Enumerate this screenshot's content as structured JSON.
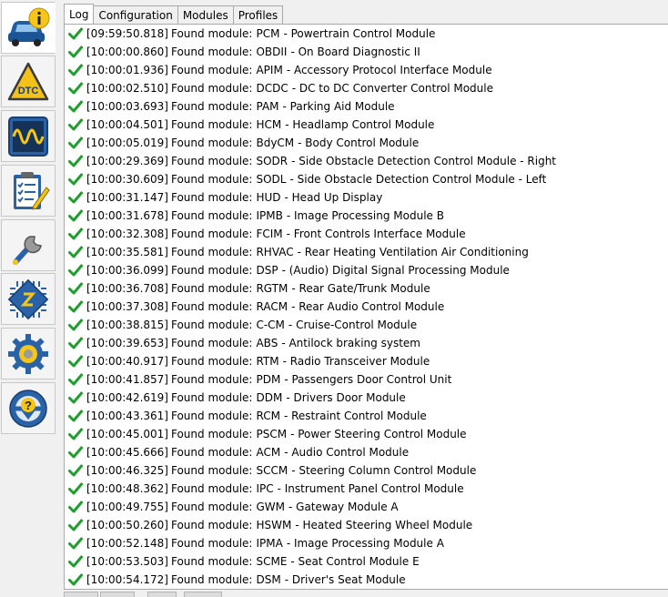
{
  "sidebar": {
    "items": [
      {
        "name": "vehicle-info",
        "icon": "car-info-icon"
      },
      {
        "name": "dtc",
        "icon": "dtc-warning-icon",
        "label": "DTC"
      },
      {
        "name": "oscilloscope",
        "icon": "oscilloscope-icon"
      },
      {
        "name": "checklist",
        "icon": "checklist-icon"
      },
      {
        "name": "service",
        "icon": "wrench-icon"
      },
      {
        "name": "module-chip",
        "icon": "chip-icon"
      },
      {
        "name": "settings",
        "icon": "gear-icon"
      },
      {
        "name": "help",
        "icon": "help-steering-icon"
      }
    ]
  },
  "tabs": [
    {
      "label": "Log",
      "active": true
    },
    {
      "label": "Configuration",
      "active": false
    },
    {
      "label": "Modules",
      "active": false
    },
    {
      "label": "Profiles",
      "active": false
    }
  ],
  "log": {
    "found_text": "Found module:",
    "entries": [
      {
        "time": "[09:59:50.818]",
        "code": "PCM",
        "desc": "- Powertrain Control Module"
      },
      {
        "time": "[10:00:00.860]",
        "code": "OBDII",
        "desc": "- On Board Diagnostic II"
      },
      {
        "time": "[10:00:01.936]",
        "code": "APIM",
        "desc": "- Accessory Protocol Interface Module"
      },
      {
        "time": "[10:00:02.510]",
        "code": "DCDC",
        "desc": "- DC to DC Converter Control Module"
      },
      {
        "time": "[10:00:03.693]",
        "code": "PAM",
        "desc": "- Parking Aid Module"
      },
      {
        "time": "[10:00:04.501]",
        "code": "HCM",
        "desc": "- Headlamp Control Module"
      },
      {
        "time": "[10:00:05.019]",
        "code": "BdyCM",
        "desc": "- Body Control Module"
      },
      {
        "time": "[10:00:29.369]",
        "code": "SODR",
        "desc": "- Side Obstacle Detection Control Module - Right"
      },
      {
        "time": "[10:00:30.609]",
        "code": "SODL",
        "desc": "- Side Obstacle Detection Control Module - Left"
      },
      {
        "time": "[10:00:31.147]",
        "code": "HUD",
        "desc": "- Head Up Display"
      },
      {
        "time": "[10:00:31.678]",
        "code": "IPMB",
        "desc": "- Image Processing Module B"
      },
      {
        "time": "[10:00:32.308]",
        "code": "FCIM",
        "desc": "- Front Controls Interface Module"
      },
      {
        "time": "[10:00:35.581]",
        "code": "RHVAC",
        "desc": "- Rear Heating Ventilation Air Conditioning"
      },
      {
        "time": "[10:00:36.099]",
        "code": "DSP",
        "desc": "- (Audio) Digital Signal Processing Module"
      },
      {
        "time": "[10:00:36.708]",
        "code": "RGTM",
        "desc": "- Rear Gate/Trunk Module"
      },
      {
        "time": "[10:00:37.308]",
        "code": "RACM",
        "desc": "- Rear Audio Control Module"
      },
      {
        "time": "[10:00:38.815]",
        "code": "C-CM",
        "desc": "- Cruise-Control Module"
      },
      {
        "time": "[10:00:39.653]",
        "code": "ABS",
        "desc": "- Antilock braking system"
      },
      {
        "time": "[10:00:40.917]",
        "code": "RTM",
        "desc": "- Radio Transceiver Module"
      },
      {
        "time": "[10:00:41.857]",
        "code": "PDM",
        "desc": "- Passengers Door Control Unit"
      },
      {
        "time": "[10:00:42.619]",
        "code": "DDM",
        "desc": "- Drivers Door Module"
      },
      {
        "time": "[10:00:43.361]",
        "code": "RCM",
        "desc": "- Restraint Control Module"
      },
      {
        "time": "[10:00:45.001]",
        "code": "PSCM",
        "desc": "- Power Steering Control Module"
      },
      {
        "time": "[10:00:45.666]",
        "code": "ACM",
        "desc": "- Audio Control Module"
      },
      {
        "time": "[10:00:46.325]",
        "code": "SCCM",
        "desc": "- Steering Column Control Module"
      },
      {
        "time": "[10:00:48.362]",
        "code": "IPC",
        "desc": "- Instrument Panel Control Module"
      },
      {
        "time": "[10:00:49.755]",
        "code": "GWM",
        "desc": "- Gateway Module A"
      },
      {
        "time": "[10:00:50.260]",
        "code": "HSWM",
        "desc": "- Heated Steering Wheel Module"
      },
      {
        "time": "[10:00:52.148]",
        "code": "IPMA",
        "desc": "- Image Processing Module A"
      },
      {
        "time": "[10:00:53.503]",
        "code": "SCME",
        "desc": "- Seat Control Module E"
      },
      {
        "time": "[10:00:54.172]",
        "code": "DSM",
        "desc": "- Driver's Seat Module"
      }
    ]
  },
  "colors": {
    "check": "#1e9e2a",
    "panel_bg": "#ffffff",
    "window_bg": "#f0f0f0"
  }
}
